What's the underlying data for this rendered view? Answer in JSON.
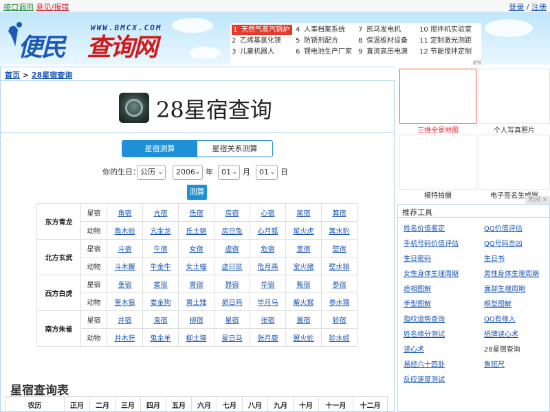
{
  "topbar": {
    "api_link": "接口调用",
    "feedback_link": "意见/报错",
    "login": "登录",
    "sep": "/",
    "register": "注册"
  },
  "logo": {
    "url": "WWW.BMCX.COM",
    "part1": "便民",
    "part2": "查询网"
  },
  "hot": [
    {
      "n": "1",
      "t": "天然气蒸汽锅炉"
    },
    {
      "n": "4",
      "t": "人事档案系统"
    },
    {
      "n": "7",
      "t": "凯马发电机"
    },
    {
      "n": "10",
      "t": "搅拌机实验室"
    },
    {
      "n": "2",
      "t": "乙烯基氯化镁"
    },
    {
      "n": "5",
      "t": "防锈剂配方"
    },
    {
      "n": "8",
      "t": "保温板材设备"
    },
    {
      "n": "11",
      "t": "定制激光测距"
    },
    {
      "n": "3",
      "t": "儿童机器人"
    },
    {
      "n": "6",
      "t": "锂电池生产厂家"
    },
    {
      "n": "9",
      "t": "直流高压电源"
    },
    {
      "n": "12",
      "t": "节能搅拌定制"
    }
  ],
  "hot_close": "×",
  "breadcrumb": {
    "home": "首页",
    "sep": ">",
    "current": "28星宿查询"
  },
  "page_title": "28星宿查询",
  "tabs": {
    "active": "星宿测算",
    "other": "星宿关系测算"
  },
  "birth": {
    "label": "你的生日：",
    "calendar": "公历",
    "year": "2006",
    "year_unit": "年",
    "month": "01",
    "month_unit": "月",
    "day": "01",
    "day_unit": "日"
  },
  "submit": "测算",
  "mansions": [
    {
      "group": "东方青龙",
      "row1_label": "星宿",
      "stars": [
        "角宿",
        "亢宿",
        "氐宿",
        "房宿",
        "心宿",
        "尾宿",
        "箕宿"
      ],
      "row2_label": "动物",
      "animals": [
        "角木蛟",
        "亢金龙",
        "氐土貉",
        "房日兔",
        "心月狐",
        "尾火虎",
        "箕水豹"
      ]
    },
    {
      "group": "北方玄武",
      "row1_label": "星宿",
      "stars": [
        "斗宿",
        "牛宿",
        "女宿",
        "虚宿",
        "危宿",
        "室宿",
        "壁宿"
      ],
      "row2_label": "动物",
      "animals": [
        "斗木獬",
        "牛金牛",
        "女土蝠",
        "虚日鼠",
        "危月燕",
        "室火猪",
        "壁水貐"
      ]
    },
    {
      "group": "西方白虎",
      "row1_label": "星宿",
      "stars": [
        "奎宿",
        "娄宿",
        "胃宿",
        "昴宿",
        "毕宿",
        "觜宿",
        "参宿"
      ],
      "row2_label": "动物",
      "animals": [
        "奎木狼",
        "娄金狗",
        "胃土雉",
        "昴日鸡",
        "毕月乌",
        "觜火猴",
        "参水猿"
      ]
    },
    {
      "group": "南方朱雀",
      "row1_label": "星宿",
      "stars": [
        "井宿",
        "鬼宿",
        "柳宿",
        "星宿",
        "张宿",
        "翼宿",
        "轸宿"
      ],
      "row2_label": "动物",
      "animals": [
        "井木犴",
        "鬼金羊",
        "柳土獐",
        "星日马",
        "张月鹿",
        "翼火蛇",
        "轸水蚓"
      ]
    }
  ],
  "table_title": "星宿查询表",
  "lunar_header": [
    "农历",
    "正月",
    "二月",
    "三月",
    "四月",
    "五月",
    "六月",
    "七月",
    "八月",
    "九月",
    "十月",
    "十一月",
    "十二月"
  ],
  "right_images": [
    {
      "caption": "三维全景地图"
    },
    {
      "caption": "个人写真照片"
    },
    {
      "caption": "模特拍摄"
    },
    {
      "caption": "电子签名生成器"
    }
  ],
  "ad_close": "关闭 ×",
  "tools": {
    "title": "推荐工具",
    "items": [
      [
        "姓名价值鉴定",
        "QQ价值评估"
      ],
      [
        "手机号码价值评估",
        "QQ号码吉凶"
      ],
      [
        "生日密码",
        "生日书"
      ],
      [
        "女性身体生理周期",
        "男性身体生理周期"
      ],
      [
        "痣相图解",
        "面部生理周期"
      ],
      [
        "手型图解",
        "眼型图解"
      ],
      [
        "指纹运势查询",
        "QQ有缘人"
      ],
      [
        "姓名缘分测试",
        "纸牌读心术"
      ],
      [
        "读心术",
        "28星宿查询"
      ],
      [
        "易经六十四卦",
        "鲁班尺"
      ],
      [
        "反应速度测试",
        ""
      ]
    ]
  }
}
